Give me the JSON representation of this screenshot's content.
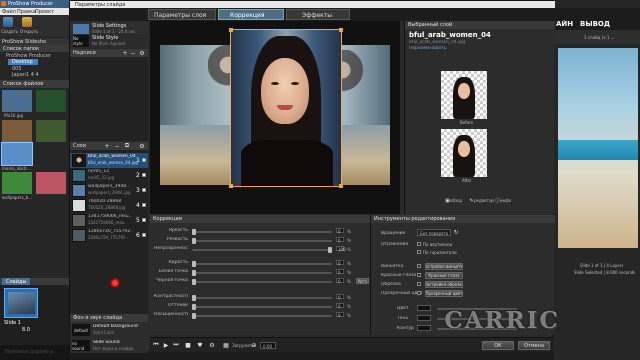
{
  "app": {
    "title": "ProShow Producer",
    "menu": [
      "Файл",
      "Правка",
      "Проект"
    ],
    "toolbar": [
      "Создать",
      "Открыть"
    ],
    "right_tabs": [
      "АЙН",
      "ВЫВОД"
    ],
    "right_status": "1 слайд (x 1 ...",
    "right_info_1": "Slide 1 of 1 | 4 Layers",
    "right_info_2": "Slide Selected | 8.000 seconds",
    "library_label": "ProShow Slidesho",
    "folders_label": "Список папок",
    "folder_root": "ProShow Producer",
    "folders": [
      "Desktop",
      "005",
      "Japan1 4 4"
    ],
    "files_label": "Список файлов",
    "files": [
      {
        "name": "fifa16.jpg",
        "color": "#4a6d92"
      },
      {
        "name": "",
        "color": "#24502a"
      },
      {
        "name": "",
        "color": "#7c5c3a"
      },
      {
        "name": "moma_abstr...",
        "color": "#5a8ec8"
      },
      {
        "name": "wallpapers_b...",
        "color": "#3d8a3c"
      },
      {
        "name": "",
        "color": "#b56"
      }
    ],
    "slides_tab": "Слайды",
    "slide_label": "Slide 1",
    "slide_time": "8.0",
    "audio_hint": "Звуковая дорожка"
  },
  "dialog": {
    "title": "Параметры слайда",
    "tabs": [
      "Параметры слоя",
      "Коррекция",
      "Эффекты"
    ],
    "active_tab": 1,
    "nav": [
      {
        "label": "Slide Settings",
        "sub": "Slide 1 of 1 - 24.0 sec"
      },
      {
        "label": "Slide Style",
        "sub": "No Style Applied"
      }
    ],
    "nav_icon_label": "No style",
    "notes_label": "Надписи",
    "layers_label": "Слои",
    "layers": [
      {
        "n": "1",
        "name": "bful_arab_women_04",
        "file": "bful_arab_women_04.jpg",
        "sel": true
      },
      {
        "n": "2",
        "name": "nor05_12",
        "file": "nor05_12.jpg",
        "sel": false
      },
      {
        "n": "3",
        "name": "wallpapers_3948..",
        "file": "wallpapers_3948..jpg",
        "sel": false
      },
      {
        "n": "4",
        "name": "760020-28868",
        "file": "760020_28868.jpg",
        "sel": false
      },
      {
        "n": "5",
        "name": "1341759066_resu..",
        "file": "1341759066_resu..",
        "sel": false
      },
      {
        "n": "6",
        "name": "1280x720_755792..",
        "file": "1280x720_755792..",
        "sel": false
      }
    ],
    "bg_label": "Фон и звук слайда",
    "bg_items": [
      {
        "icon": "default",
        "label": "Default Background",
        "sub": "Solid Color"
      },
      {
        "icon": "no sound",
        "label": "Slide Sound",
        "sub": "Нет звука в слайде"
      }
    ],
    "selected_layer_label": "Выбранный слой",
    "selected_layer_name": "bful_arab_women_04",
    "selected_layer_file": "bful_arab_women_04.jpg",
    "selected_layer_link": "Переименовать",
    "before_label": "Before",
    "after_label": "After",
    "preview_buttons": [
      "обзор",
      "редактор",
      "инфо"
    ],
    "corrections_label": "Коррекции",
    "corrections": [
      {
        "label": "Яркость",
        "value": 0
      },
      {
        "label": "Резкость",
        "value": 0
      },
      {
        "label": "Непрозрачность",
        "value": 100
      },
      {
        "label": "Ядрость",
        "value": 0
      },
      {
        "label": "Белая точка",
        "value": 0
      },
      {
        "label": "Черная точка",
        "value": 0
      },
      {
        "label": "Контрастность",
        "value": 0
      },
      {
        "label": "Оттенок",
        "value": 0
      },
      {
        "label": "Насыщенность",
        "value": 0
      }
    ],
    "auto_label": "Авто",
    "tools_label": "Инструменты редактирования",
    "rotation_label": "Вращение",
    "rotation_value": "Без поворота",
    "mirror_label": "Отражение",
    "flip_v": "По вертикали",
    "flip_h": "По горизонтали",
    "tool_rows": [
      {
        "label": "Виньетка",
        "btn": "Настройка виньетки"
      },
      {
        "label": "Красные глаза",
        "btn": "Красные глаза"
      },
      {
        "label": "Обрезка",
        "btn": "Настройка обрезки"
      },
      {
        "label": "Прозрачный цвет",
        "btn": "Прозрачный цвет"
      }
    ],
    "color_rows": [
      "Цвет",
      "Тень",
      "Контур"
    ],
    "footer_time": "0:00",
    "footer_label": "Загрузить",
    "ok_label": "ОК",
    "cancel_label": "Отмена",
    "watermark": "CARRIC"
  },
  "colors": {
    "accent": "#3a86c8",
    "selected_row": "#24507e",
    "panel": "#2b2b2b",
    "tab_active": "#4e6d88",
    "cursor": "#cc0000"
  }
}
